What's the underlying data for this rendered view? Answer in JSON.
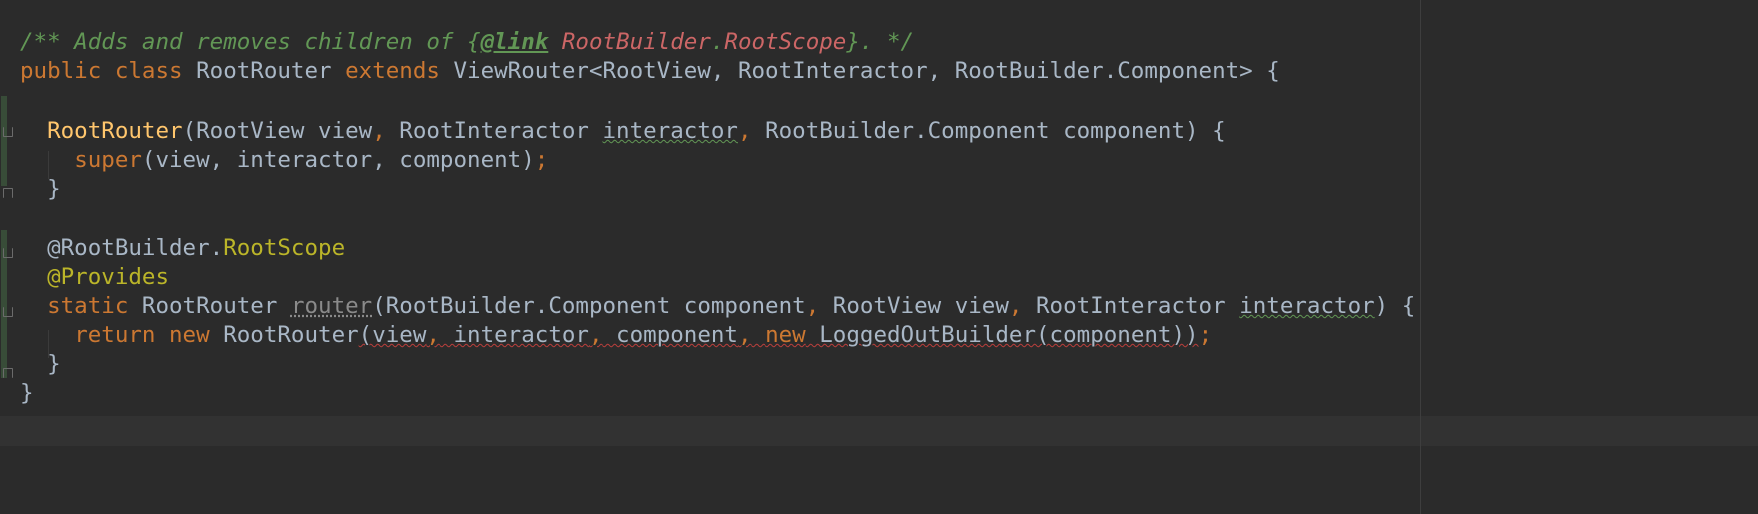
{
  "editor": {
    "lines": {
      "l1": {
        "comment_open": "/** Adds and removes children of {",
        "link_tag": "@link",
        "space": " ",
        "ref_a": "RootBuilder",
        "dot": ".",
        "ref_b": "RootScope",
        "comment_close": "}. */"
      },
      "l2": {
        "public": "public",
        "class": "class",
        "name": "RootRouter",
        "extends": "extends",
        "parent": "ViewRouter<RootView, RootInteractor, RootBuilder.Component> {"
      },
      "l4": {
        "ctor": "RootRouter",
        "p1": "(RootView view",
        "c1": ",",
        "p2": " RootInteractor ",
        "interactor": "interactor",
        "c2": ",",
        "p3": " RootBuilder.Component component) {"
      },
      "l5": {
        "super": "super",
        "args": "(view, interactor, component)",
        "semi": ";"
      },
      "l6": {
        "brace": "}"
      },
      "l8": {
        "at_root": "@RootBuilder.",
        "root_scope": "RootScope"
      },
      "l9": {
        "provides": "@Provides"
      },
      "l10": {
        "static": "static",
        "type": " RootRouter ",
        "method": "router",
        "p1": "(RootBuilder.Component component",
        "c1": ",",
        "p2": " RootView view",
        "c2": ",",
        "p3": " RootInteractor ",
        "interactor": "interactor",
        "p4": ") {"
      },
      "l11": {
        "return": "return",
        "new1": "new",
        "ctor": " RootRouter",
        "args_open": "(view",
        "c1": ",",
        "a2": " interactor",
        "c2": ",",
        "a3": " component",
        "c3": ",",
        "new2": "new",
        "builder": " LoggedOutBuilder(component))",
        "semi": ";"
      },
      "l12": {
        "brace": "}"
      },
      "l13": {
        "brace": "}"
      }
    },
    "colors": {
      "background": "#2b2b2b",
      "keyword": "#cc7832",
      "comment": "#629755",
      "annotation": "#bbb529",
      "method_declaration": "#ffc66d",
      "default_text": "#a9b7c6"
    }
  }
}
